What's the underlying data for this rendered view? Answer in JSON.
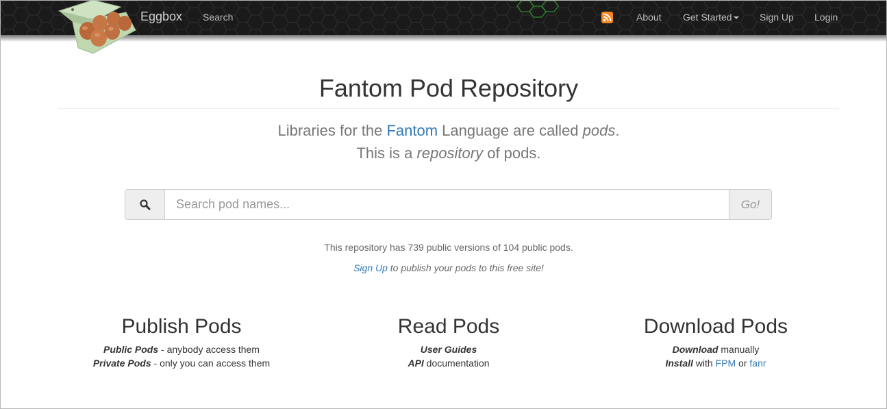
{
  "navbar": {
    "brand": "Eggbox",
    "search_link": "Search",
    "about": "About",
    "get_started": "Get Started",
    "sign_up": "Sign Up",
    "login": "Login",
    "rss_color": "#f6861f",
    "background_color": "#1a1a1a"
  },
  "main": {
    "title": "Fantom Pod Repository",
    "lead1": {
      "prefix": "Libraries for the ",
      "link": "Fantom",
      "middle": " Language are called ",
      "em": "pods",
      "suffix": "."
    },
    "lead2": {
      "prefix": "This is a ",
      "em": "repository",
      "suffix": " of pods."
    },
    "search": {
      "placeholder": "Search pod names...",
      "value": "",
      "go_label": "Go!"
    },
    "stats": "This repository has 739 public versions of 104 public pods.",
    "signup": {
      "link": "Sign Up",
      "rest": " to publish your pods to this free site!"
    }
  },
  "columns": {
    "publish": {
      "title": "Publish Pods",
      "line1_bold": "Public Pods",
      "line1_rest": " - anybody access them",
      "line2_bold": "Private Pods",
      "line2_rest": " - only you can access them"
    },
    "read": {
      "title": "Read Pods",
      "line1_bold": "User Guides",
      "line2_bold": "API",
      "line2_rest": " documentation"
    },
    "download": {
      "title": "Download Pods",
      "line1_bold": "Download",
      "line1_rest": " manually",
      "line2_bold": "Install",
      "line2_mid": " with ",
      "link1": "FPM",
      "line2_or": " or ",
      "link2": "fanr"
    }
  },
  "colors": {
    "link": "#337ab7",
    "muted": "#777777",
    "text": "#333333"
  }
}
